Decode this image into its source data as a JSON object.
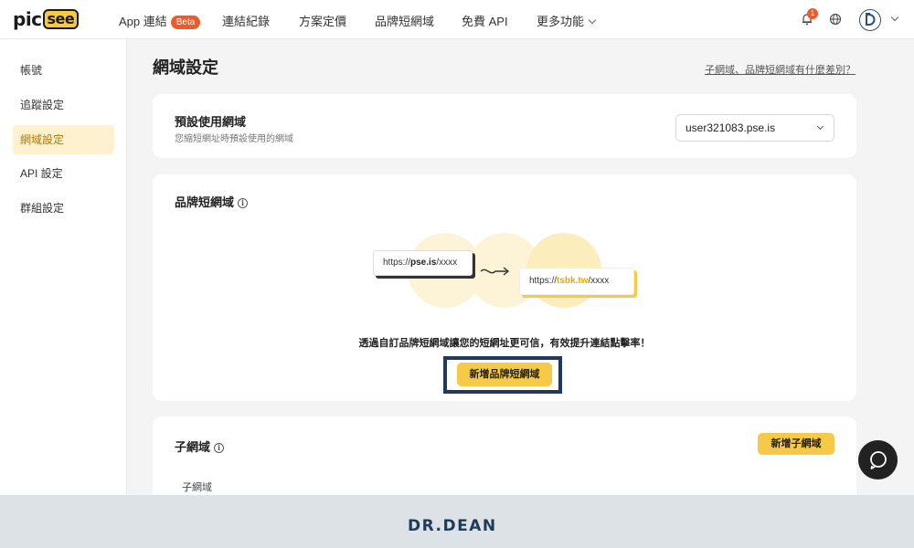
{
  "nav": {
    "logo_pic": "pic",
    "logo_see": "see",
    "items": [
      {
        "label": "App 連結",
        "badge": "Beta"
      },
      {
        "label": "連結紀錄"
      },
      {
        "label": "方案定價"
      },
      {
        "label": "品牌短網域"
      },
      {
        "label": "免費 API"
      },
      {
        "label": "更多功能"
      }
    ],
    "notification_count": "1",
    "icons": [
      "bell-icon",
      "globe-icon",
      "avatar"
    ]
  },
  "sidebar": {
    "items": [
      {
        "label": "帳號"
      },
      {
        "label": "追蹤設定"
      },
      {
        "label": "網域設定",
        "active": true
      },
      {
        "label": "API 設定"
      },
      {
        "label": "群組設定"
      }
    ]
  },
  "main": {
    "title": "網域設定",
    "diff_link": "子網域、品牌短網域有什麼差別？",
    "default_domain": {
      "title": "預設使用網域",
      "subtitle": "您縮短網址時預設使用的網域",
      "selected": "user321083.pse.is"
    },
    "brand_domain": {
      "title": "品牌短網域",
      "url_before_prefix": "https://",
      "url_before_domain": "pse.is",
      "url_before_suffix": "/xxxx",
      "url_after_prefix": "https://",
      "url_after_domain": "tsbk.tw",
      "url_after_suffix": "/xxxx",
      "promo": "透過自訂品牌短網域讓您的短網址更可信，有效提升連結點擊率！",
      "button": "新增品牌短網域"
    },
    "subdomain": {
      "title": "子網域",
      "button": "新增子網域",
      "column": "子網域"
    }
  },
  "footer": {
    "logo": "DR.DEAN"
  },
  "colors": {
    "accent": "#f7c948",
    "badge": "#f05a28",
    "frame": "#1f3a5a"
  }
}
